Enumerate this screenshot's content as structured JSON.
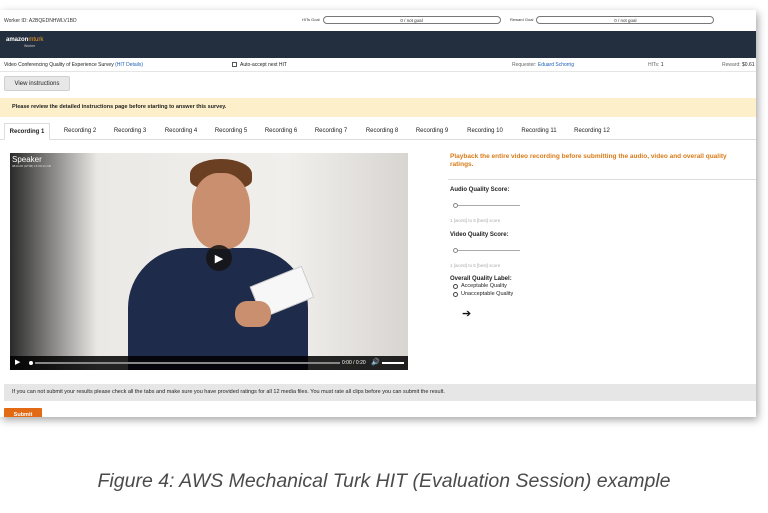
{
  "topbar": {
    "worker_id": "Worker ID: A2BQEDNHWLV1BD",
    "hits_goal_label": "HITs Goal",
    "hits_goal_value": "0 / not goal",
    "reward_goal_label": "Reward Goal",
    "reward_goal_value": "0 / not goal"
  },
  "brand": {
    "name": "amazon",
    "mt": "mturk",
    "sub": "Worker"
  },
  "hit": {
    "title": "Video Conferencing Quality of Experience Survey",
    "details_link": "(HIT Details)",
    "auto_accept": "Auto-accept next HIT",
    "requester_label": "Requester:",
    "requester": "Eduard Schorrig",
    "hits_label": "HITs:",
    "hits_value": "1",
    "reward_label": "Reward:",
    "reward_value": "$0.61"
  },
  "buttons": {
    "view_instructions": "View instructions",
    "submit": "Submit"
  },
  "banner": "Please review the detailed instructions page before starting to answer this survey.",
  "tabs": [
    "Recording 1",
    "Recording 2",
    "Recording 3",
    "Recording 4",
    "Recording 5",
    "Recording 6",
    "Recording 7",
    "Recording 8",
    "Recording 9",
    "Recording 10",
    "Recording 11",
    "Recording 12"
  ],
  "video": {
    "speaker_label": "Speaker",
    "speaker_sub": "0813-06 (HT08) 13:09:44 GB",
    "time": "0:00 / 0:20"
  },
  "form": {
    "instruction": "Playback the entire video recording before submitting the audio, video and overall quality ratings.",
    "audio_label": "Audio Quality Score:",
    "audio_hint": "1 [worst] to 5 [best] score",
    "video_label": "Video Quality Score:",
    "video_hint": "1 [worst] to 5 [best] score",
    "overall_label": "Overall Quality Label:",
    "options": [
      "Acceptable Quality",
      "Unacceptable Quality"
    ],
    "next_icon": "arrow-right-icon"
  },
  "footer_note": "If you can not submit your results please check all the tabs and make sure you have provided ratings for all 12 media files. You must rate all clips before you can submit the result.",
  "caption": "Figure 4: AWS Mechanical Turk HIT (Evaluation Session) example",
  "colors": {
    "accent": "#e36a15",
    "instruction": "#d97a16",
    "banner": "#fcefc9",
    "brand_bar": "#232f3e"
  }
}
